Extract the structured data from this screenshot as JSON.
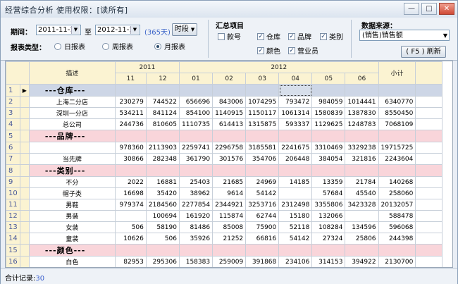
{
  "window": {
    "title": "经营综合分析  使用权限：[读所有]",
    "min": "—",
    "max": "□",
    "close": "✕"
  },
  "filters": {
    "period_label": "期间：",
    "date_from": "2011-11-12",
    "to_label": "至",
    "date_to": "2012-11-10",
    "days": "(365天)",
    "period_button": "时段",
    "report_type_label": "报表类型：",
    "report_types": [
      {
        "label": "日报表",
        "selected": false
      },
      {
        "label": "周报表",
        "selected": false
      },
      {
        "label": "月报表",
        "selected": true
      }
    ]
  },
  "summary": {
    "label": "汇总项目",
    "items": [
      {
        "label": "款号",
        "checked": false
      },
      {
        "label": "仓库",
        "checked": true
      },
      {
        "label": "品牌",
        "checked": true
      },
      {
        "label": "类别",
        "checked": true
      },
      {
        "label": "颜色",
        "checked": true
      },
      {
        "label": "营业员",
        "checked": true
      }
    ]
  },
  "source": {
    "label": "数据来源：",
    "selected": "(销售)销售额",
    "refresh_button": "( F5 ) 刷新"
  },
  "grid": {
    "header": {
      "desc": "描述",
      "y2011": "2011",
      "y2012": "2012",
      "total": "小计",
      "months": [
        "11",
        "12",
        "01",
        "02",
        "03",
        "04",
        "05",
        "06"
      ]
    },
    "rows": [
      {
        "n": "1",
        "desc": "---仓库---",
        "type": "gray",
        "cells": [
          "",
          "",
          "",
          "",
          "",
          "",
          "",
          ""
        ],
        "total": "",
        "pointer": true
      },
      {
        "n": "2",
        "desc": "上海二分店",
        "cells": [
          "230279",
          "744522",
          "656696",
          "843006",
          "1074295",
          "793472",
          "984059",
          "1014441"
        ],
        "total": "6340770"
      },
      {
        "n": "3",
        "desc": "深圳一分店",
        "cells": [
          "534211",
          "841124",
          "854100",
          "1140915",
          "1150117",
          "1061314",
          "1580839",
          "1387830"
        ],
        "total": "8550450"
      },
      {
        "n": "4",
        "desc": "总公司",
        "cells": [
          "244736",
          "810605",
          "1110735",
          "614413",
          "1315875",
          "593337",
          "1129625",
          "1248783"
        ],
        "total": "7068109"
      },
      {
        "n": "5",
        "desc": "---品牌---",
        "type": "pink",
        "cells": [
          "",
          "",
          "",
          "",
          "",
          "",
          "",
          ""
        ],
        "total": ""
      },
      {
        "n": "6",
        "desc": "",
        "cells": [
          "978360",
          "2113903",
          "2259741",
          "2296758",
          "3185581",
          "2241675",
          "3310469",
          "3329238"
        ],
        "total": "19715725"
      },
      {
        "n": "7",
        "desc": "当先牌",
        "cells": [
          "30866",
          "282348",
          "361790",
          "301576",
          "354706",
          "206448",
          "384054",
          "321816"
        ],
        "total": "2243604"
      },
      {
        "n": "8",
        "desc": "---类别---",
        "type": "pink",
        "cells": [
          "",
          "",
          "",
          "",
          "",
          "",
          "",
          ""
        ],
        "total": ""
      },
      {
        "n": "9",
        "desc": "不分",
        "cells": [
          "2022",
          "16881",
          "25403",
          "21685",
          "24969",
          "14185",
          "13359",
          "21784"
        ],
        "total": "140268"
      },
      {
        "n": "10",
        "desc": "帽子类",
        "cells": [
          "16698",
          "35420",
          "38962",
          "9614",
          "54142",
          "",
          "57684",
          "45540"
        ],
        "total": "258060"
      },
      {
        "n": "11",
        "desc": "男鞋",
        "cells": [
          "979374",
          "2184560",
          "2277854",
          "2344921",
          "3253716",
          "2312498",
          "3355806",
          "3423328"
        ],
        "total": "20132057"
      },
      {
        "n": "12",
        "desc": "男装",
        "cells": [
          "",
          "100694",
          "161920",
          "115874",
          "62744",
          "15180",
          "132066",
          ""
        ],
        "total": "588478"
      },
      {
        "n": "13",
        "desc": "女装",
        "cells": [
          "506",
          "58190",
          "81486",
          "85008",
          "75900",
          "52118",
          "108284",
          "134596"
        ],
        "total": "596068"
      },
      {
        "n": "14",
        "desc": "童装",
        "cells": [
          "10626",
          "506",
          "35926",
          "21252",
          "66816",
          "54142",
          "27324",
          "25806"
        ],
        "total": "244398"
      },
      {
        "n": "15",
        "desc": "---颜色---",
        "type": "pink",
        "cells": [
          "",
          "",
          "",
          "",
          "",
          "",
          "",
          ""
        ],
        "total": ""
      },
      {
        "n": "16",
        "desc": "白色",
        "cells": [
          "82953",
          "295306",
          "158383",
          "259009",
          "391868",
          "234106",
          "314153",
          "394922"
        ],
        "total": "2130700"
      }
    ]
  },
  "status": {
    "label": "合计记录:",
    "count": "30"
  }
}
